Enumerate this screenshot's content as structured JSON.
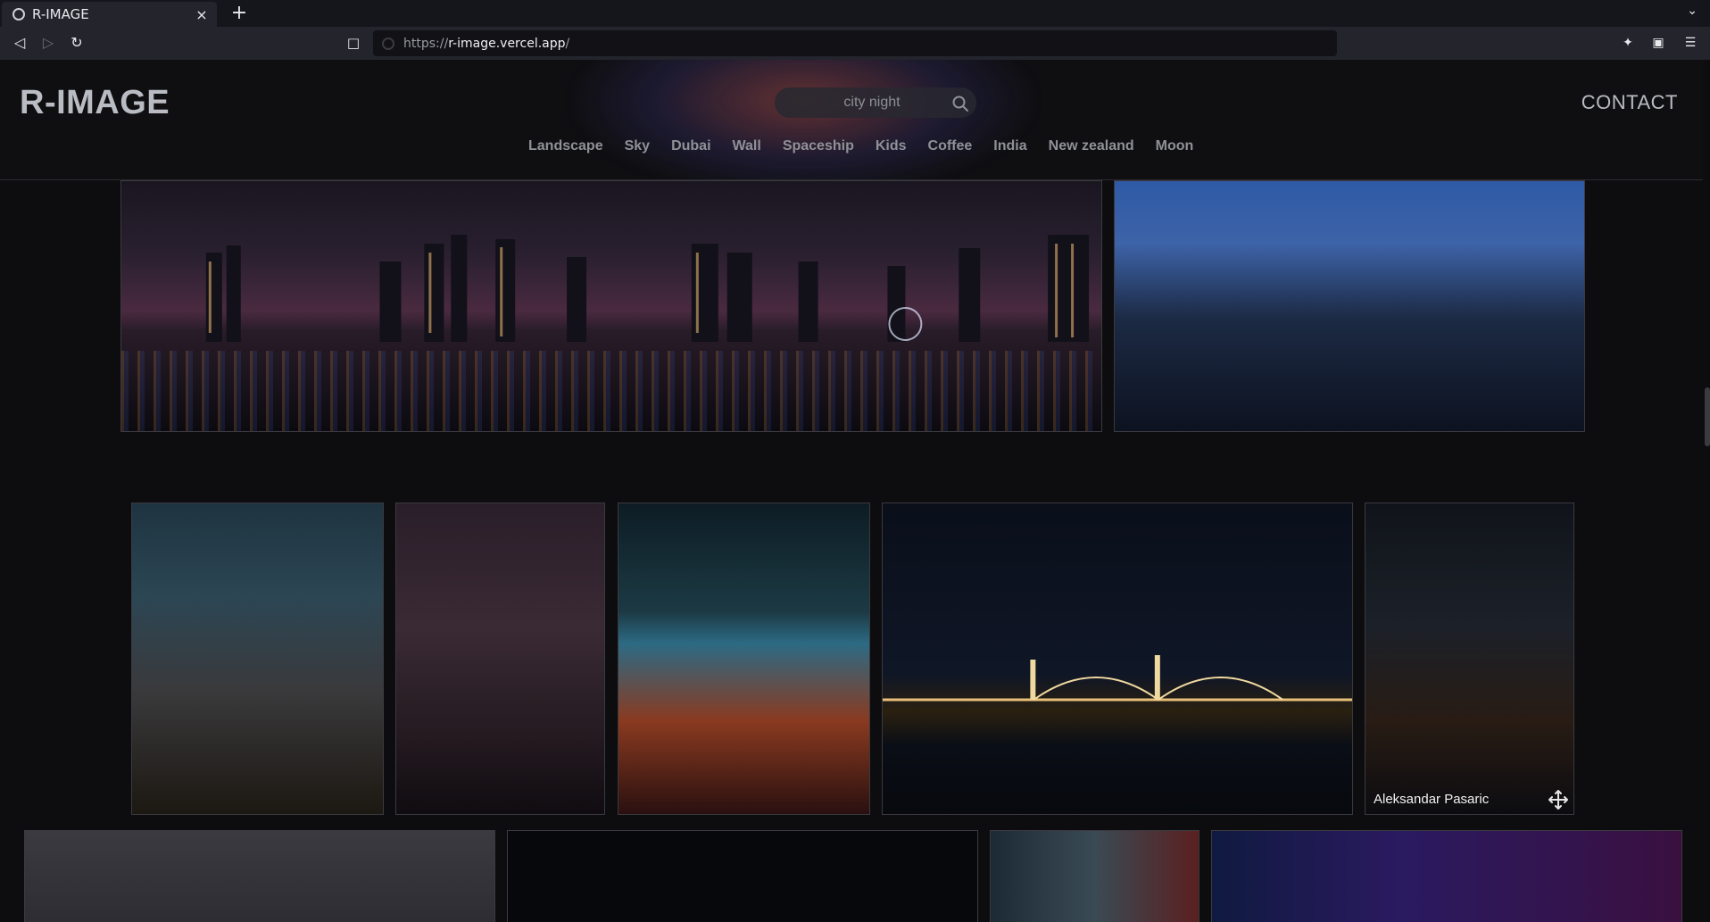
{
  "browser": {
    "tab_title": "R-IMAGE",
    "tab_close": "×",
    "new_tab": "+",
    "url_scheme": "https://",
    "url_host": "r-image.vercel.app",
    "url_path": "/"
  },
  "site": {
    "logo": "R-IMAGE",
    "contact": "CONTACT",
    "search_placeholder": "city night",
    "categories": [
      "Landscape",
      "Sky",
      "Dubai",
      "Wall",
      "Spaceship",
      "Kids",
      "Coffee",
      "India",
      "New zealand",
      "Moon"
    ]
  },
  "gallery": {
    "credit": "Aleksandar Pasaric"
  }
}
